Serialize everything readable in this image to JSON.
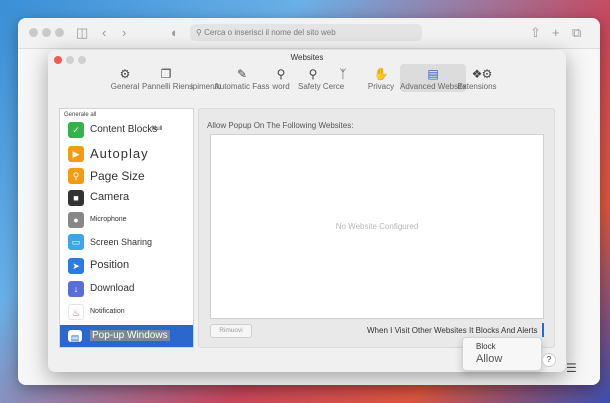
{
  "browser": {
    "address_placeholder": "Cerca o inserisci il nome del sito web"
  },
  "settings": {
    "title": "Websites",
    "tabs": [
      {
        "label": "General",
        "icon": "gear-icon"
      },
      {
        "label": "Pannelli Riens",
        "icon": "tabs-icon"
      },
      {
        "label": "ipimento",
        "icon": "autofill-icon"
      },
      {
        "label": "Automatic Fass",
        "icon": "autofill-icon"
      },
      {
        "label": "word",
        "icon": "key-icon"
      },
      {
        "label": "Safety Cerce",
        "icon": "search-icon"
      },
      {
        "label": "",
        "icon": "security-icon"
      },
      {
        "label": "Privacy",
        "icon": "hand-icon"
      },
      {
        "label": "Advanced Website",
        "icon": "globe-icon"
      },
      {
        "label": "Extensions",
        "icon": "puzzle-icon"
      },
      {
        "label": "",
        "icon": "advanced-icon"
      }
    ],
    "sidebar": {
      "section_label": "Generale all",
      "items": [
        {
          "label": "Content Blocks",
          "suffix": "Null",
          "icon": "shield-check-icon",
          "color": "#33b44a"
        },
        {
          "label": "Autoplay",
          "icon": "play-icon",
          "color": "#f39c12"
        },
        {
          "label": "Page Size",
          "icon": "magnifier-icon",
          "color": "#f39c12"
        },
        {
          "label": "Camera",
          "icon": "camera-icon",
          "color": "#333333"
        },
        {
          "label": "Microphone",
          "icon": "microphone-icon",
          "color": "#888888"
        },
        {
          "label": "Screen Sharing",
          "icon": "screen-icon",
          "color": "#3ba7e6"
        },
        {
          "label": "Position",
          "icon": "location-arrow-icon",
          "color": "#2c7be5"
        },
        {
          "label": "Download",
          "icon": "download-icon",
          "color": "#5a6fd6"
        },
        {
          "label": "Notification",
          "icon": "bell-icon",
          "color": "#e74c3c"
        },
        {
          "label": "Pop-up Windows",
          "icon": "popup-window-icon",
          "color": "#2c67d0"
        }
      ]
    },
    "main": {
      "allow_label": "Allow Popup On The Following Websites:",
      "empty_text": "No Website Configured",
      "remove_button": "Rimuovi",
      "when_label": "When I Visit Other Websites It Blocks And Alerts"
    },
    "dropdown": {
      "options": [
        "Block",
        "Allow"
      ]
    },
    "help_label": "?"
  },
  "colors": {
    "accent": "#2c67d0",
    "close": "#ee5a52",
    "minimize": "#f5bf4f",
    "maximize": "#61c554"
  }
}
